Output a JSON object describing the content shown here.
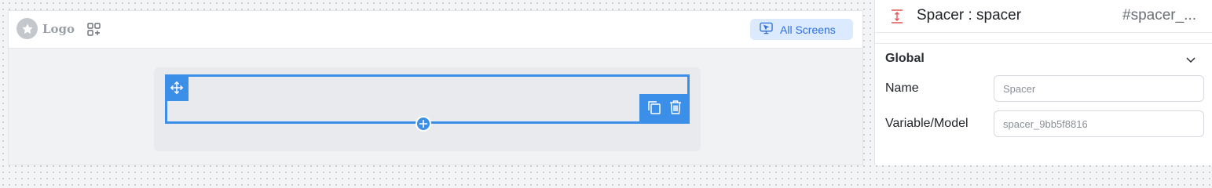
{
  "canvas": {
    "logo_text": "Logo",
    "all_screens_label": "All Screens"
  },
  "panel": {
    "title": "Spacer : spacer",
    "element_id": "#spacer_...",
    "section_title": "Global",
    "fields": [
      {
        "label": "Name",
        "value": "",
        "placeholder": "Spacer"
      },
      {
        "label": "Variable/Model",
        "value": "",
        "placeholder": "spacer_9bb5f8816"
      }
    ]
  },
  "colors": {
    "selection_blue": "#3b8fe8",
    "all_screens_bg": "#dbeafe",
    "all_screens_text": "#2f6fde",
    "spacer_icon": "#e25555"
  },
  "icons": {
    "logo": "star-icon",
    "widgets": "grid-add-icon",
    "screens": "monitor-cursor-icon",
    "move": "move-icon",
    "duplicate": "copy-icon",
    "delete": "trash-icon",
    "add": "plus-icon",
    "spacer": "spacer-icon",
    "collapse": "chevron-down-icon"
  }
}
